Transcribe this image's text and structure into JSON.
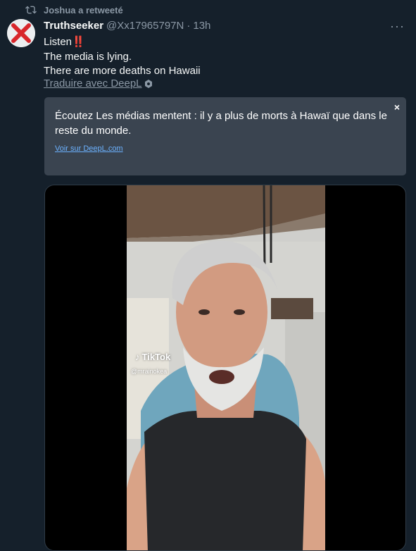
{
  "retweet": {
    "label": "Joshua a retweeté"
  },
  "tweet": {
    "display_name": "Truthseeker",
    "handle": "@Xx17965797N",
    "separator": "·",
    "time": "13h",
    "more_label": "···",
    "lines": [
      "Listen",
      "The media is lying.",
      "There are more deaths on Hawaii"
    ],
    "emphasis": "‼️",
    "translate_label": "Traduire avec DeepL"
  },
  "deepl": {
    "translation": "Écoutez Les médias mentent : il y a plus de morts à Hawaï que dans le reste du monde.",
    "link_label": "Voir sur DeepL.com",
    "close_label": "×"
  },
  "video": {
    "watermark_brand": "TikTok",
    "watermark_user": "@mrainokea"
  },
  "colors": {
    "background": "#15202b",
    "secondary_text": "#8b98a5",
    "deepl_box": "#3a4450",
    "link": "#6cb2ff"
  }
}
